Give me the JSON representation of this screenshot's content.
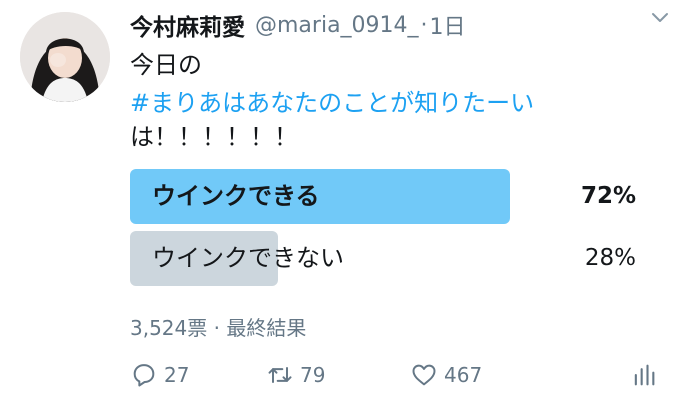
{
  "tweet": {
    "author": {
      "display_name": "今村麻莉愛",
      "handle": "@maria_0914_",
      "avatar_icon": "avatar-photo"
    },
    "separator": "·",
    "time": "1日",
    "text": {
      "line1": "今日の",
      "hashtag": "#まりあはあなたのことが知りたーい",
      "line3": "は！！！！！！"
    }
  },
  "poll": {
    "options": [
      {
        "label": "ウインクできる",
        "percent_label": "72%",
        "percent": 72
      },
      {
        "label": "ウインクできない",
        "percent_label": "28%",
        "percent": 28
      }
    ],
    "footer": "3,524票 · 最終結果"
  },
  "actions": {
    "reply_count": "27",
    "retweet_count": "79",
    "like_count": "467"
  },
  "colors": {
    "winning_bar": "#71c9f8",
    "losing_bar": "#ccd6dd",
    "hashtag": "#1da1f2",
    "muted": "#657786"
  }
}
